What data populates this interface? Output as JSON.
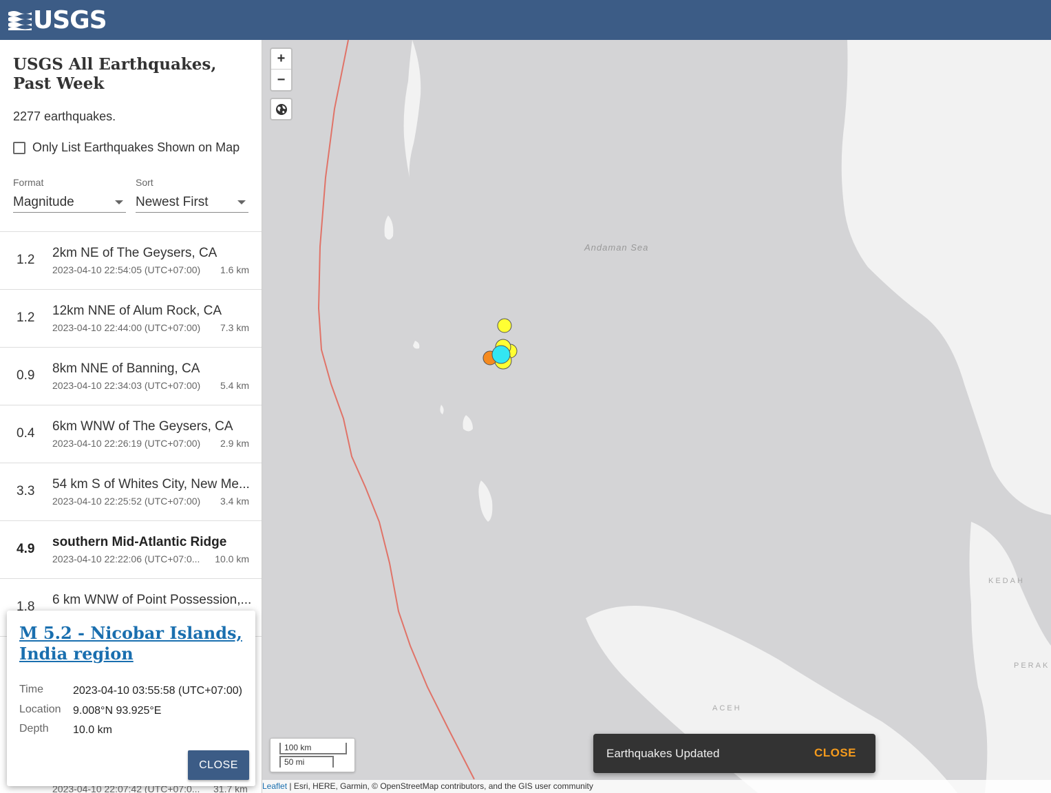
{
  "header": {
    "logo_text": "USGS",
    "logo_icon": "usgs-wave-icon",
    "background": "#3c5c86"
  },
  "sidebar": {
    "title": "USGS All Earthquakes, Past Week",
    "count_text": "2277 earthquakes.",
    "only_list_label": "Only List Earthquakes Shown on Map",
    "only_list_checked": false,
    "format": {
      "label": "Format",
      "value": "Magnitude"
    },
    "sort": {
      "label": "Sort",
      "value": "Newest First"
    },
    "earthquakes": [
      {
        "mag": "1.2",
        "place": "2km NE of The Geysers, CA",
        "time": "2023-04-10 22:54:05 (UTC+07:00)",
        "depth": "1.6 km"
      },
      {
        "mag": "1.2",
        "place": "12km NNE of Alum Rock, CA",
        "time": "2023-04-10 22:44:00 (UTC+07:00)",
        "depth": "7.3 km"
      },
      {
        "mag": "0.9",
        "place": "8km NNE of Banning, CA",
        "time": "2023-04-10 22:34:03 (UTC+07:00)",
        "depth": "5.4 km"
      },
      {
        "mag": "0.4",
        "place": "6km WNW of The Geysers, CA",
        "time": "2023-04-10 22:26:19 (UTC+07:00)",
        "depth": "2.9 km"
      },
      {
        "mag": "3.3",
        "place": "54 km S of Whites City, New Me...",
        "time": "2023-04-10 22:25:52 (UTC+07:00)",
        "depth": "3.4 km"
      },
      {
        "mag": "4.9",
        "place": "southern Mid-Atlantic Ridge",
        "time": "2023-04-10 22:22:06 (UTC+07:0...",
        "depth": "10.0 km"
      },
      {
        "mag": "1.8",
        "place": "6 km WNW of Point Possession,...",
        "time": "",
        "depth": ""
      }
    ],
    "peek_time": "2023-04-10 22:07:42 (UTC+07:0...",
    "peek_depth": "31.7 km"
  },
  "popup": {
    "title": "M 5.2 - Nicobar Islands, India region",
    "time_label": "Time",
    "time_value": "2023-04-10 03:55:58 (UTC+07:00)",
    "location_label": "Location",
    "location_value": "9.008°N 93.925°E",
    "depth_label": "Depth",
    "depth_value": "10.0 km",
    "close_label": "CLOSE"
  },
  "map": {
    "zoom_in": "+",
    "zoom_out": "−",
    "basemap_icon": "globe-icon",
    "sea_label": "Andaman Sea",
    "regions": [
      "KEDAH",
      "PERAK",
      "ACEH"
    ],
    "scale_km": "100 km",
    "scale_mi": "50 mi",
    "attribution_link": "Leaflet",
    "attribution_text": " | Esri, HERE, Garmin, © OpenStreetMap contributors, and the GIS user community",
    "colors": {
      "water": "#d4d4d6",
      "land": "#f2f2f2",
      "plate_boundary": "#e07368",
      "quake_recent": "#ffff33",
      "quake_hour": "#f58a1f",
      "quake_selected": "#33e6f2"
    }
  },
  "toast": {
    "text": "Earthquakes Updated",
    "close_label": "CLOSE"
  }
}
